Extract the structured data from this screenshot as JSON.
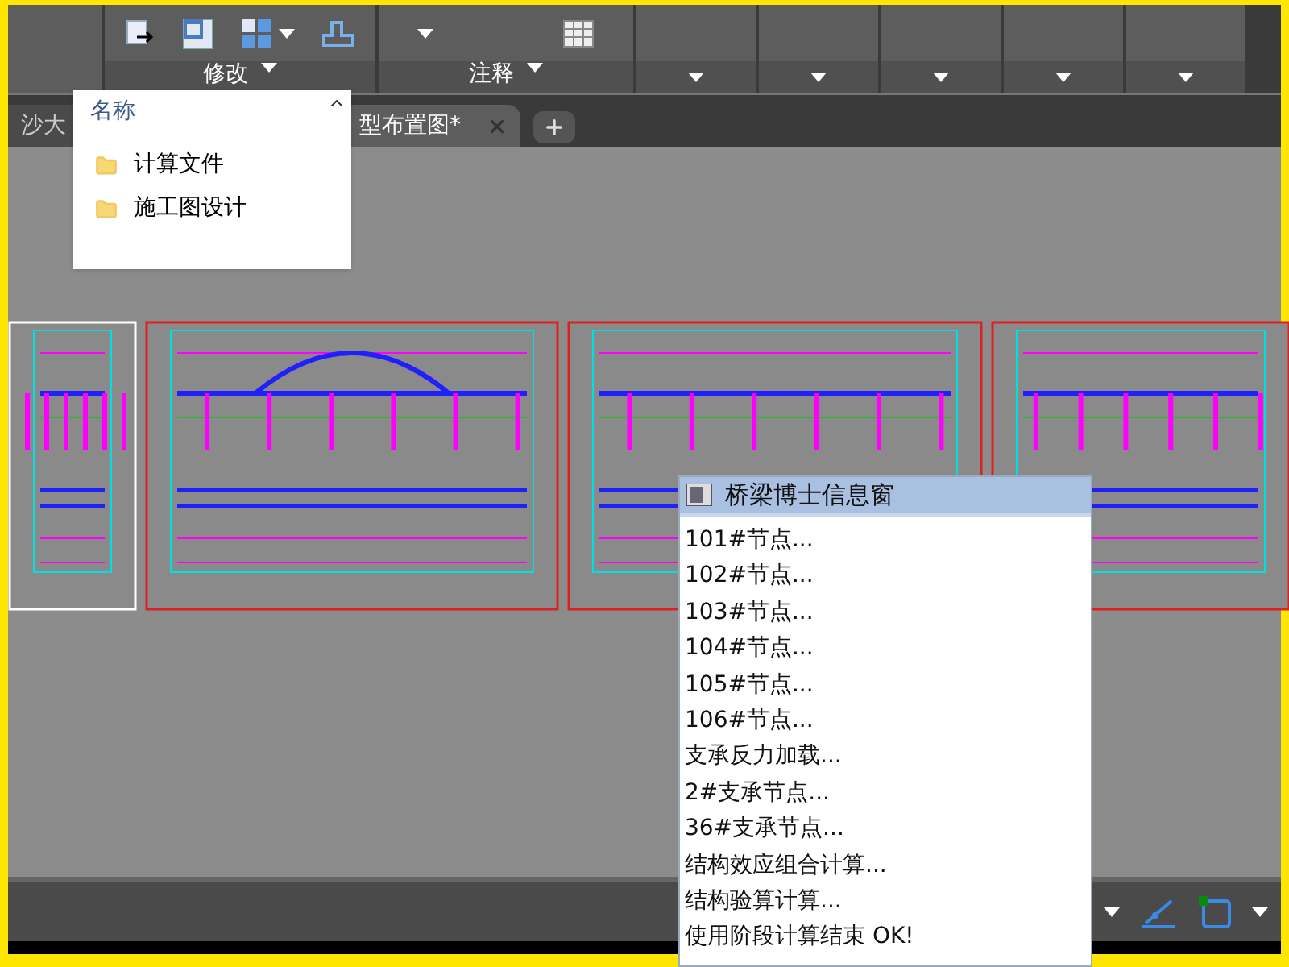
{
  "ribbon": {
    "panels": [
      {
        "label": "修改",
        "kind": "modify"
      },
      {
        "label": "注释",
        "kind": "annotate"
      }
    ]
  },
  "file_tabs": [
    {
      "label": "沙大",
      "selected": false
    },
    {
      "label": "型布置图*",
      "selected": true
    }
  ],
  "name_popup": {
    "header": "名称",
    "items": [
      {
        "label": "计算文件"
      },
      {
        "label": "施工图设计"
      }
    ]
  },
  "info_window": {
    "title": "桥梁博士信息窗",
    "lines": [
      "101#节点...",
      "102#节点...",
      "103#节点...",
      "104#节点...",
      "105#节点...",
      "106#节点...",
      "支承反力加载...",
      "2#支承节点...",
      "36#支承节点...",
      "结构效应组合计算...",
      "结构验算计算...",
      "使用阶段计算结束 OK!"
    ]
  }
}
